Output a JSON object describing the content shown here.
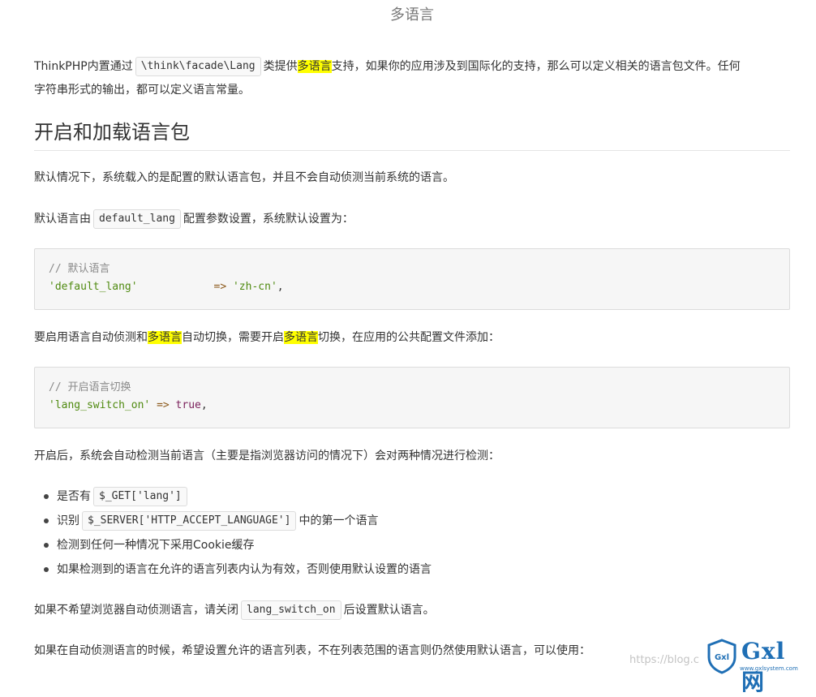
{
  "page": {
    "title": "多语言"
  },
  "intro": {
    "before": "ThinkPHP内置通过",
    "code": "\\think\\facade\\Lang",
    "mid": "类提供",
    "highlight": "多语言",
    "after_line1": "支持，如果你的应用涉及到国际化的支持，那么可以定义相关的语言包文件。任何",
    "line2": "字符串形式的输出，都可以定义语言常量。"
  },
  "section": {
    "heading": "开启和加载语言包"
  },
  "p1": {
    "text": "默认情况下，系统载入的是配置的默认语言包，并且不会自动侦测当前系统的语言。"
  },
  "p2": {
    "before": "默认语言由",
    "code": "default_lang",
    "after": "配置参数设置，系统默认设置为："
  },
  "code1": {
    "comment": "// 默认语言",
    "key": "'default_lang'",
    "spacing": "           ",
    "op": "=>",
    "value": "'zh-cn'",
    "trail": ","
  },
  "p3": {
    "before": "要启用语言自动侦测和",
    "hl1": "多语言",
    "mid": "自动切换，需要开启",
    "hl2": "多语言",
    "after": "切换，在应用的公共配置文件添加："
  },
  "code2": {
    "comment": "// 开启语言切换",
    "key": "'lang_switch_on'",
    "op": "=>",
    "value": "true",
    "trail": ","
  },
  "p4": {
    "text": "开启后，系统会自动检测当前语言（主要是指浏览器访问的情况下）会对两种情况进行检测："
  },
  "bullets": {
    "b1_before": "是否有",
    "b1_code": "$_GET['lang']",
    "b2_before": "识别",
    "b2_code": "$_SERVER['HTTP_ACCEPT_LANGUAGE']",
    "b2_after": "中的第一个语言",
    "b3": "检测到任何一种情况下采用Cookie缓存",
    "b4": "如果检测到的语言在允许的语言列表内认为有效，否则使用默认设置的语言"
  },
  "p5": {
    "before": "如果不希望浏览器自动侦测语言，请关闭",
    "code": "lang_switch_on",
    "after": "后设置默认语言。"
  },
  "p6": {
    "text": "如果在自动侦测语言的时候，希望设置允许的语言列表，不在列表范围的语言则仍然使用默认语言，可以使用："
  },
  "watermark": {
    "text": "https://blog.c",
    "brand": "Gxl 网",
    "shield": "Gxl",
    "url": "www.gxlsystem.com"
  }
}
